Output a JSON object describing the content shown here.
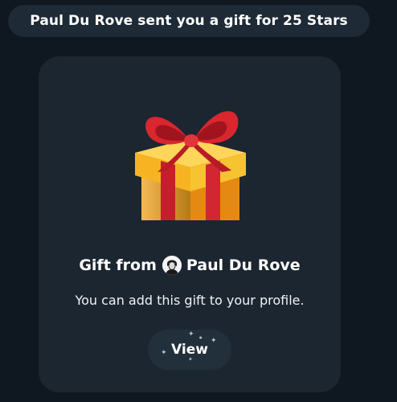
{
  "service_message": "Paul Du Rove sent you a gift for 25 Stars",
  "gift": {
    "icon": "gift-box-icon",
    "title_prefix": "Gift from",
    "sender_name": "Paul Du Rove",
    "description": "You can add this gift to your profile.",
    "button_label": "View"
  },
  "colors": {
    "background": "#0f1720",
    "card": "#1c2630",
    "pill": "#1e2a35",
    "box": "#f4a925",
    "ribbon": "#c8202a"
  }
}
